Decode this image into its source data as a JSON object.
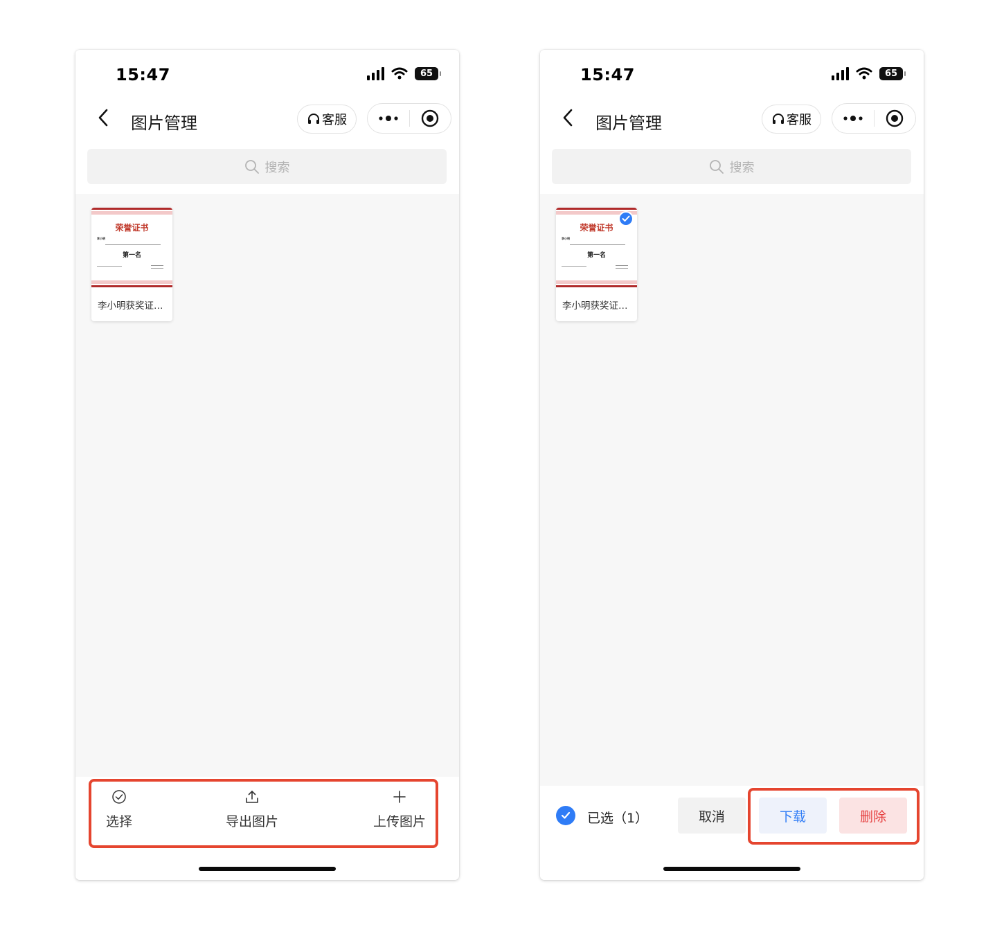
{
  "status_bar": {
    "time": "15:47",
    "battery": "65"
  },
  "nav": {
    "title": "图片管理",
    "service_label": "客服"
  },
  "search": {
    "placeholder": "搜索"
  },
  "image_item": {
    "label": "李小明获奖证…",
    "certificate": {
      "title": "荣誉证书",
      "recipient": "李小明",
      "rank": "第一名"
    }
  },
  "left_toolbar": {
    "select_label": "选择",
    "export_label": "导出图片",
    "upload_label": "上传图片"
  },
  "right_toolbar": {
    "selected_text": "已选（1）",
    "cancel_label": "取消",
    "download_label": "下载",
    "delete_label": "删除"
  },
  "colors": {
    "highlight": "#e5452f",
    "accent_blue": "#2f7cf6",
    "delete_red": "#e64040",
    "certificate_red": "#c0392b"
  }
}
